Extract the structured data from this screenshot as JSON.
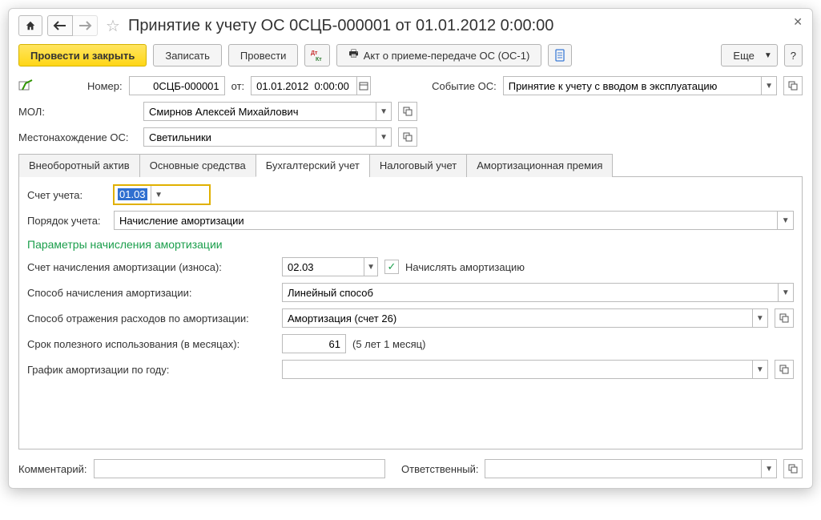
{
  "title": "Принятие к учету ОС 0СЦБ-000001 от 01.01.2012 0:00:00",
  "toolbar": {
    "post_close": "Провести и закрыть",
    "save": "Записать",
    "post": "Провести",
    "print_act": "Акт о приеме-передаче ОС (ОС-1)",
    "more": "Еще"
  },
  "header": {
    "number_label": "Номер:",
    "number": "0СЦБ-000001",
    "ot": "от:",
    "date": "01.01.2012  0:00:00",
    "event_label": "Событие ОС:",
    "event": "Принятие к учету с вводом в эксплуатацию",
    "mol_label": "МОЛ:",
    "mol": "Смирнов Алексей Михайлович",
    "loc_label": "Местонахождение ОС:",
    "loc": "Светильники"
  },
  "tabs": {
    "t1": "Внеоборотный актив",
    "t2": "Основные средства",
    "t3": "Бухгалтерский учет",
    "t4": "Налоговый учет",
    "t5": "Амортизационная премия"
  },
  "bu": {
    "account_label": "Счет учета:",
    "account": "01.03",
    "order_label": "Порядок учета:",
    "order": "Начисление амортизации",
    "section": "Параметры начисления амортизации",
    "amort_acc_label": "Счет начисления амортизации (износа):",
    "amort_acc": "02.03",
    "calc_amort": "Начислять амортизацию",
    "method_label": "Способ начисления амортизации:",
    "method": "Линейный способ",
    "expense_label": "Способ отражения расходов по амортизации:",
    "expense": "Амортизация (счет 26)",
    "life_label": "Срок полезного использования (в месяцах):",
    "life": "61",
    "life_hint": "(5 лет 1 месяц)",
    "schedule_label": "График амортизации по году:",
    "schedule": ""
  },
  "footer": {
    "comment_label": "Комментарий:",
    "comment": "",
    "responsible_label": "Ответственный:",
    "responsible": ""
  }
}
